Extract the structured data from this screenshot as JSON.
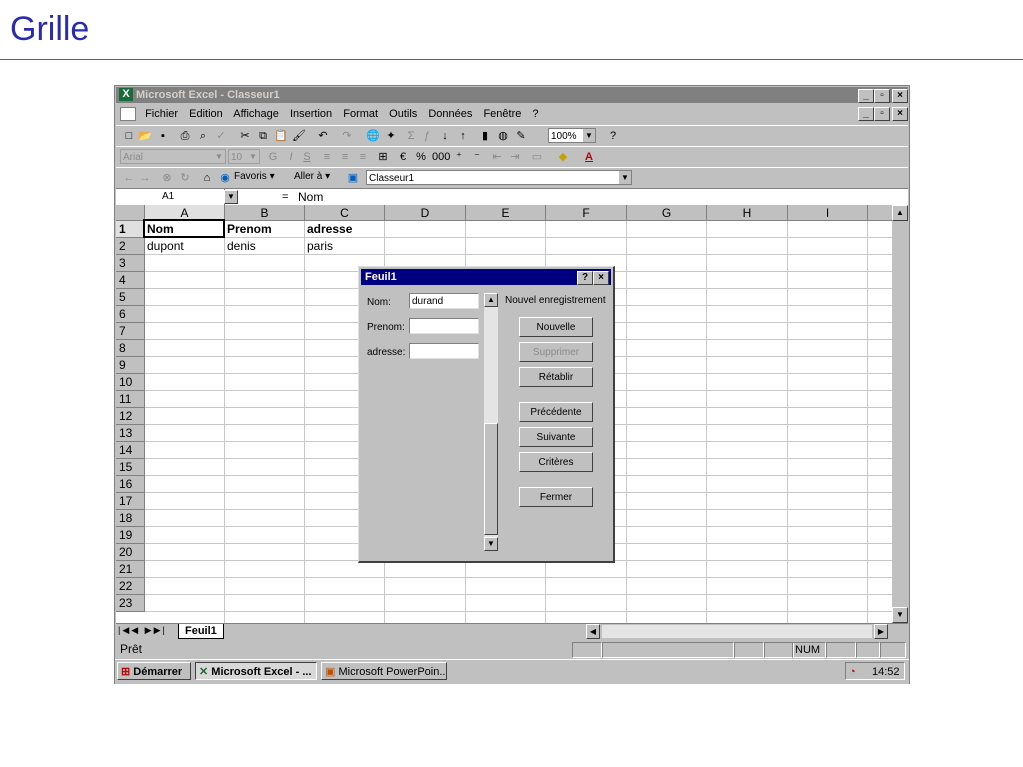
{
  "slide": {
    "title": "Grille"
  },
  "window": {
    "title": "Microsoft Excel - Classeur1",
    "menu": [
      "Fichier",
      "Edition",
      "Affichage",
      "Insertion",
      "Format",
      "Outils",
      "Données",
      "Fenêtre",
      "?"
    ],
    "zoom": "100%",
    "font_name": "Arial",
    "font_size": "10",
    "web_favorites": "Favoris",
    "web_goto": "Aller à",
    "address": "Classeur1",
    "name_box": "A1",
    "formula_value": "Nom"
  },
  "sheet": {
    "columns": [
      "A",
      "B",
      "C",
      "D",
      "E",
      "F",
      "G",
      "H",
      "I"
    ],
    "rows": [
      "1",
      "2",
      "3",
      "4",
      "5",
      "6",
      "7",
      "8",
      "9",
      "10",
      "11",
      "12",
      "13",
      "14",
      "15",
      "16",
      "17",
      "18",
      "19",
      "20",
      "21",
      "22",
      "23"
    ],
    "cells": {
      "A1": "Nom",
      "B1": "Prenom",
      "C1": "adresse",
      "A2": "dupont",
      "B2": "denis",
      "C2": "paris"
    },
    "tab": "Feuil1"
  },
  "status": {
    "left": "Prêt",
    "num": "NUM"
  },
  "taskbar": {
    "start": "Démarrer",
    "items": [
      "Microsoft Excel - ...",
      "Microsoft PowerPoin..."
    ],
    "clock": "14:52"
  },
  "dialog": {
    "title": "Feuil1",
    "fields": [
      {
        "label": "Nom:",
        "value": "durand"
      },
      {
        "label": "Prenom:",
        "value": ""
      },
      {
        "label": "adresse:",
        "value": ""
      }
    ],
    "record_info": "Nouvel enregistrement",
    "buttons": [
      "Nouvelle",
      "Supprimer",
      "Rétablir",
      "Précédente",
      "Suivante",
      "Critères",
      "Fermer"
    ]
  }
}
